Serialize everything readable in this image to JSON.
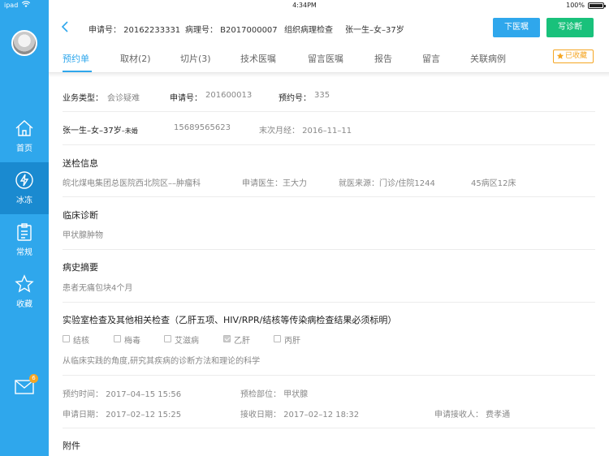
{
  "status": {
    "carrier": "ipad",
    "time": "4:34PM",
    "battery": "100%"
  },
  "sidebar": {
    "items": [
      {
        "label": "首页",
        "icon": "home-icon"
      },
      {
        "label": "冰冻",
        "icon": "lightning-icon",
        "active": true
      },
      {
        "label": "常规",
        "icon": "clipboard-icon"
      },
      {
        "label": "收藏",
        "icon": "star-icon"
      }
    ],
    "mail_badge": "6"
  },
  "header": {
    "apply_no": "申请号：  20162233331",
    "path_no": "病理号：  B2017000007",
    "exam_type": "组织病理检查",
    "patient": "张一生–女–37岁",
    "btn_download": "下医嘱",
    "btn_diagnose": "写诊断"
  },
  "tabs": [
    "预约单",
    "取材(2)",
    "切片(3)",
    "技术医嘱",
    "留言医嘱",
    "报告",
    "留言",
    "关联病例"
  ],
  "favorite": "已收藏",
  "detail": {
    "biz_type_label": "业务类型：",
    "biz_type": "会诊疑难",
    "apply_label": "申请号：",
    "apply": "201600013",
    "booking_label": "预约号：",
    "booking": "335",
    "patient_name": "张一生–女–37岁",
    "marital": "–未婚",
    "phone": "15689565623",
    "lmp": "末次月经：  2016–11–11",
    "send_title": "送检信息",
    "hospital": "皖北煤电集团总医院西北院区––肿瘤科",
    "doctor": "申请医生：王大力",
    "source": "就医来源：门诊/住院1244",
    "ward": "45病区12床",
    "clinical_title": "临床诊断",
    "clinical": "甲状腺肿物",
    "history_title": "病史摘要",
    "history": "患者无痛包块4个月",
    "lab_title": "实验室检查及其他相关检查（乙肝五项、HIV/RPR/结核等传染病检查结果必须标明）",
    "checks": [
      {
        "label": "结核",
        "checked": false
      },
      {
        "label": "梅毒",
        "checked": false
      },
      {
        "label": "艾滋病",
        "checked": false
      },
      {
        "label": "乙肝",
        "checked": true
      },
      {
        "label": "丙肝",
        "checked": false
      }
    ],
    "lab_note": "从临床实践的角度,研究其疾病的诊断方法和理论的科学",
    "booking_time": "预约时间：  2017–04–15 15:56",
    "site": "预检部位：  甲状腺",
    "apply_date": "申请日期：  2017–02–12 15:25",
    "receive_date": "接收日期：  2017–02–12 18:32",
    "receiver": "申请接收人：  费孝通",
    "attachment_title": "附件"
  }
}
